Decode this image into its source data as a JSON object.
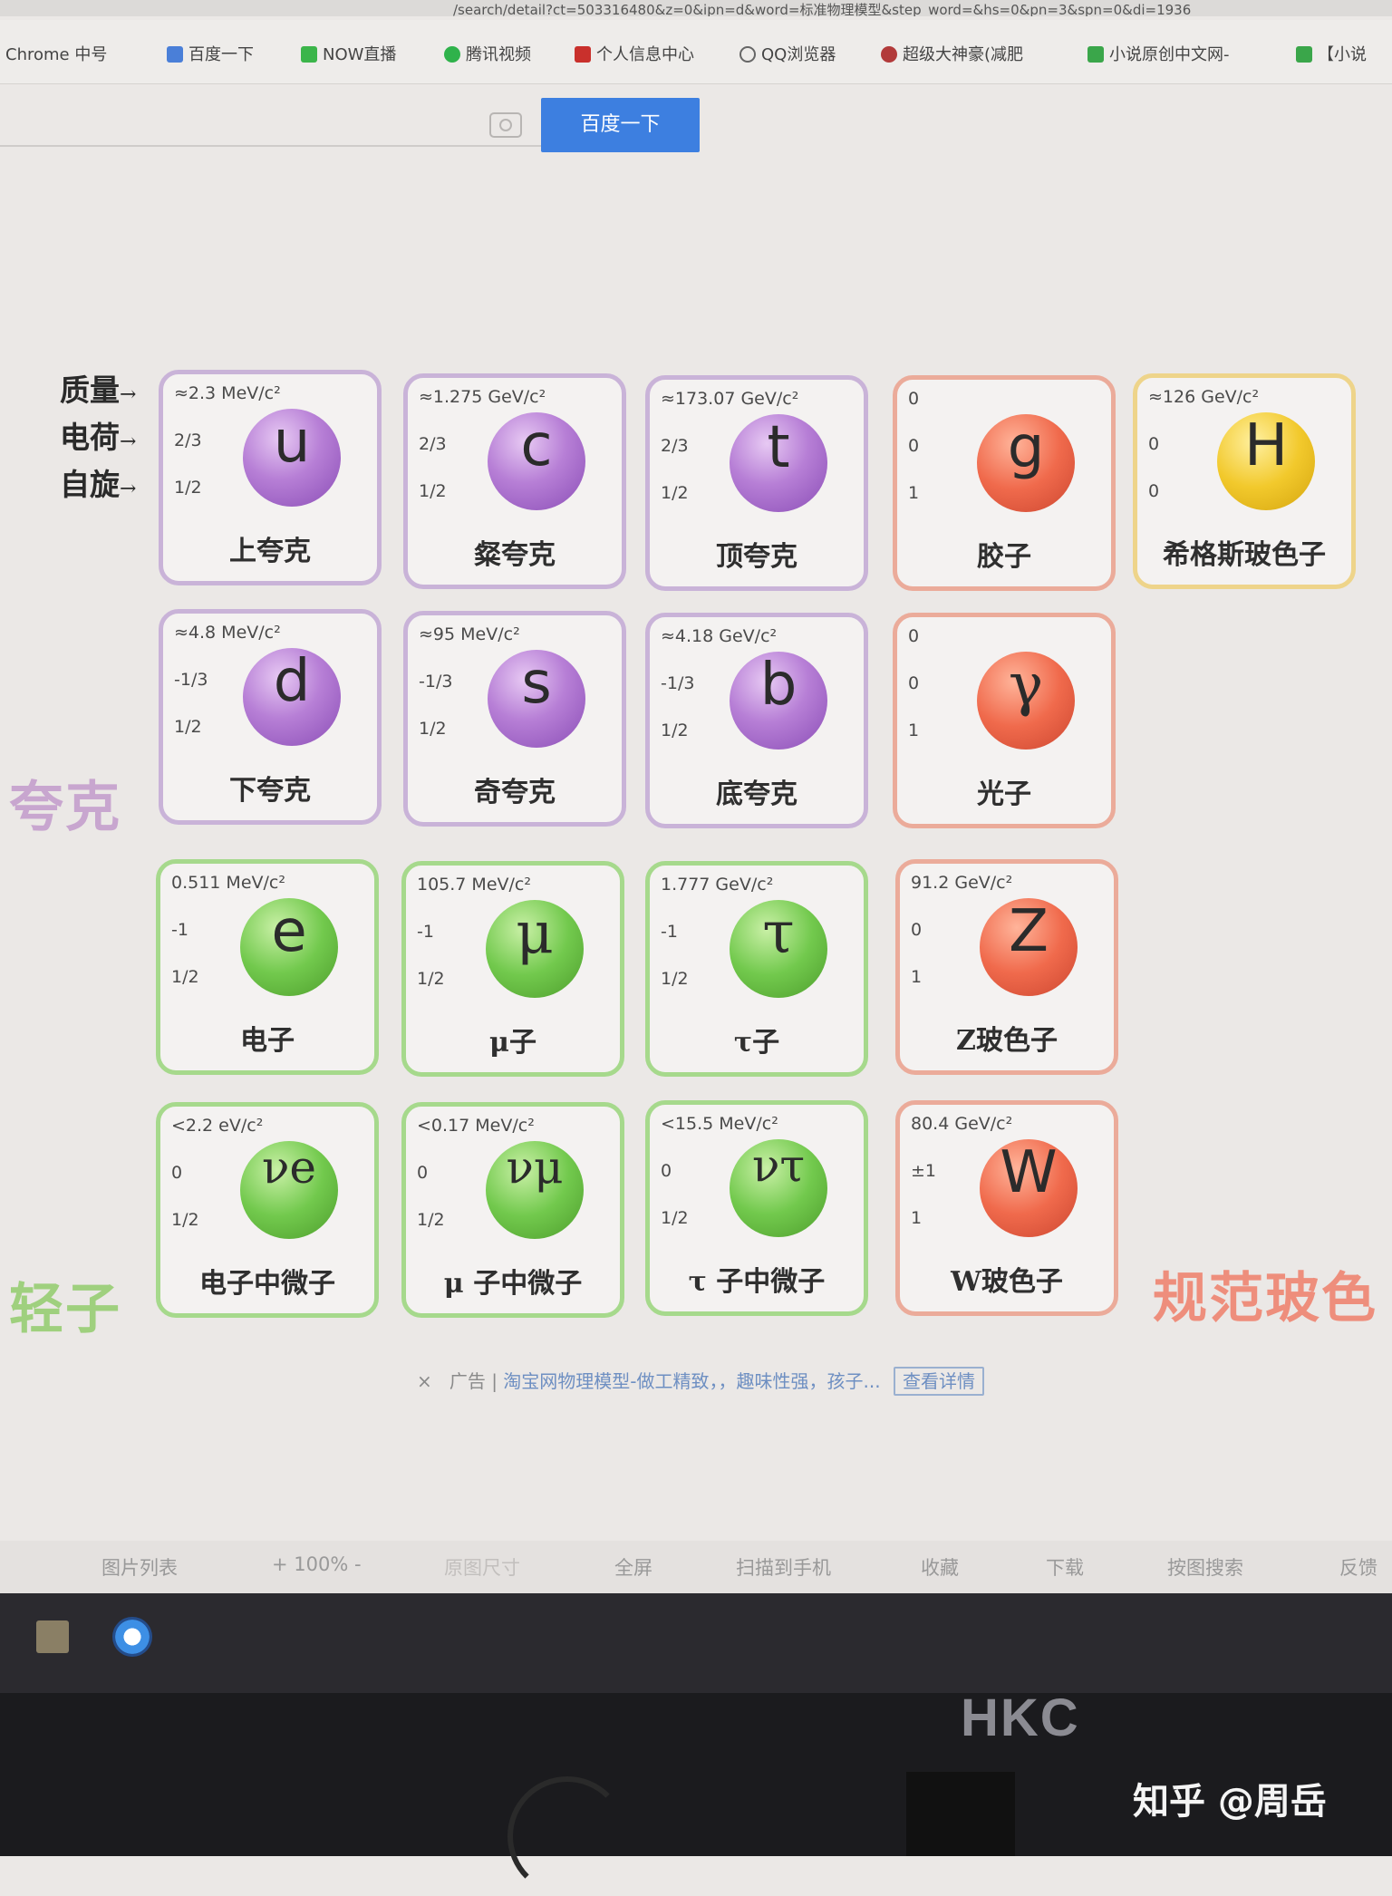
{
  "browser": {
    "url": "/search/detail?ct=503316480&z=0&ipn=d&word=标准物理模型&step_word=&hs=0&pn=3&spn=0&di=1936",
    "bookmarks": [
      "Chrome 中号",
      "百度一下",
      "NOW直播",
      "腾讯视频",
      "个人信息中心",
      "QQ浏览器",
      "超级大神豪(减肥",
      "小说原创中文网-",
      "【小说"
    ],
    "search_button": "百度一下"
  },
  "row_labels": {
    "mass": "质量",
    "charge": "电荷",
    "spin": "自旋"
  },
  "groups": {
    "quarks": "夸克",
    "leptons": "轻子",
    "gauge_bosons": "规范玻色"
  },
  "particles": [
    {
      "key": "u",
      "symbol": "u",
      "mass": "≈2.3 MeV/c²",
      "charge": "2/3",
      "spin": "1/2",
      "name": "上夸克"
    },
    {
      "key": "c",
      "symbol": "c",
      "mass": "≈1.275 GeV/c²",
      "charge": "2/3",
      "spin": "1/2",
      "name": "粲夸克"
    },
    {
      "key": "t",
      "symbol": "t",
      "mass": "≈173.07 GeV/c²",
      "charge": "2/3",
      "spin": "1/2",
      "name": "顶夸克"
    },
    {
      "key": "g",
      "symbol": "g",
      "mass": "0",
      "charge": "0",
      "spin": "1",
      "name": "胶子"
    },
    {
      "key": "H",
      "symbol": "H",
      "mass": "≈126 GeV/c²",
      "charge": "0",
      "spin": "0",
      "name": "希格斯玻色子"
    },
    {
      "key": "d",
      "symbol": "d",
      "mass": "≈4.8 MeV/c²",
      "charge": "-1/3",
      "spin": "1/2",
      "name": "下夸克"
    },
    {
      "key": "s",
      "symbol": "s",
      "mass": "≈95 MeV/c²",
      "charge": "-1/3",
      "spin": "1/2",
      "name": "奇夸克"
    },
    {
      "key": "b",
      "symbol": "b",
      "mass": "≈4.18 GeV/c²",
      "charge": "-1/3",
      "spin": "1/2",
      "name": "底夸克"
    },
    {
      "key": "gamma",
      "symbol": "γ",
      "mass": "0",
      "charge": "0",
      "spin": "1",
      "name": "光子"
    },
    {
      "key": "e",
      "symbol": "e",
      "mass": "0.511 MeV/c²",
      "charge": "-1",
      "spin": "1/2",
      "name": "电子"
    },
    {
      "key": "mu",
      "symbol": "μ",
      "mass": "105.7 MeV/c²",
      "charge": "-1",
      "spin": "1/2",
      "name": "μ子"
    },
    {
      "key": "tau",
      "symbol": "τ",
      "mass": "1.777 GeV/c²",
      "charge": "-1",
      "spin": "1/2",
      "name": "τ子"
    },
    {
      "key": "Z",
      "symbol": "Z",
      "mass": "91.2 GeV/c²",
      "charge": "0",
      "spin": "1",
      "name": "Z玻色子"
    },
    {
      "key": "nue",
      "symbol": "νe",
      "mass": "<2.2 eV/c²",
      "charge": "0",
      "spin": "1/2",
      "name": "电子中微子"
    },
    {
      "key": "numu",
      "symbol": "νμ",
      "mass": "<0.17 MeV/c²",
      "charge": "0",
      "spin": "1/2",
      "name": "μ 子中微子"
    },
    {
      "key": "nutau",
      "symbol": "ντ",
      "mass": "<15.5 MeV/c²",
      "charge": "0",
      "spin": "1/2",
      "name": "τ 子中微子"
    },
    {
      "key": "W",
      "symbol": "W",
      "mass": "80.4 GeV/c²",
      "charge": "±1",
      "spin": "1",
      "name": "W玻色子"
    }
  ],
  "ad": {
    "close": "×",
    "label": "广告",
    "text": "淘宝网物理模型-做工精致，，趣味性强，孩子...",
    "button": "查看详情"
  },
  "viewer_toolbar": [
    "图片列表",
    "+ 100% -",
    "原图尺寸",
    "全屏",
    "扫描到手机",
    "收藏",
    "下载",
    "按图搜索",
    "反馈"
  ],
  "monitor_brand": "HKC",
  "watermark": "知乎 @周岳",
  "colors": {
    "quark": "#b77fd6",
    "lepton": "#72c94d",
    "boson": "#f06a4c",
    "higgs": "#f2c92c",
    "quark_label": "#c8a6cf",
    "lepton_label": "#9fd07e",
    "boson_label": "#ee8e7c"
  }
}
